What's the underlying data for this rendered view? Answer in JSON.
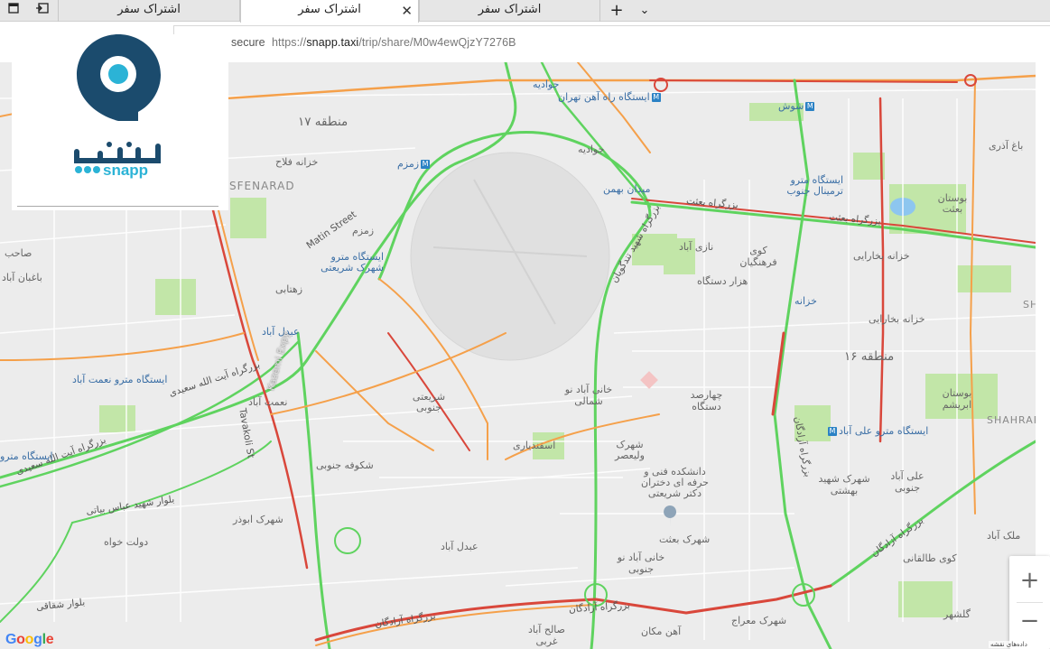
{
  "browser": {
    "tabs": [
      {
        "label": "اشتراک سفر",
        "active": false
      },
      {
        "label": "اشتراک سفر",
        "active": true
      },
      {
        "label": "اشتراک سفر",
        "active": false
      }
    ],
    "new_tab_symbol": "+",
    "tab_list_symbol": "⌄",
    "close_symbol": "✕",
    "icons": {
      "tab_actions": "tab-actions-icon",
      "set_aside": "set-aside-tabs-icon"
    },
    "address": {
      "secure_label": "secure",
      "url_scheme": "https://",
      "url_domain": "snapp.taxi",
      "url_path": "/trip/share/M0w4ewQjzY7276B"
    }
  },
  "logo": {
    "text_fa": "اسنپ",
    "text_en": "snapp",
    "brand_color": "#1b4b6d",
    "accent_color": "#2bb3d6"
  },
  "map": {
    "provider": "Google",
    "attribution": "داده‌های نقشه",
    "zoom_in_label": "+",
    "zoom_out_label": "−",
    "colors": {
      "traffic_green": "#5fd35f",
      "traffic_orange": "#f5a04a",
      "traffic_red": "#d9473b",
      "park": "#c2e6a8",
      "water": "#8dc6ef",
      "metro": "#2b82c5"
    },
    "labels": {
      "region17": "منطقه ۱۷",
      "region16": "منطقه ۱۶",
      "javadieh1": "جوادیه",
      "javadieh2": "جوادیه",
      "rah_ahan": "ایستگاه راه آهن تهران",
      "shoush": "شوش",
      "bagh_azari": "باغ آذری",
      "khazaneh_falah": "خزانه فلاح",
      "zamzam": "زمزم",
      "zamzam2": "زمزم",
      "sfenarad": "SFENARAD",
      "meydan_bahman": "میدان بهمن",
      "terminal_jonoub": "ایستگاه مترو ترمینال جنوب",
      "bustan_besat": "بوستان بعثت",
      "bozorgrah_besat": "بزرگراه بعثت",
      "azadegan_saeed": "بزرگراه شهید تندگویان",
      "shahrak_shariati_station": "ایستگاه مترو شهرک شریعتی",
      "matin_street": "Matin Street",
      "zahtabi": "زهتابی",
      "bazi_abad": "نازی آباد",
      "kooy_farhangian": "کوی فرهنگیان",
      "hezar_dastgah": "هزار دستگاه",
      "khazaneh": "خزانه",
      "khazaneh_bokharaei": "خزانه بخارایی",
      "khazaneh_bokharaei2": "خزانه بخارایی",
      "sh_right": "SH",
      "abdol_abad_station": "عبدل آباد",
      "kazemi_expy": "Kazemi Expy",
      "nemat_abad_station": "ایستگاه مترو نعمت آباد",
      "nemat_abad": "نعمت آباد",
      "shariati_jonoubi": "شریعتی جنوبی",
      "khani_abad_shomali": "خانی آباد نو شمالی",
      "chaharsad_dastgah": "چهارصد دستگاه",
      "esfandiari": "اسفندیاری",
      "valiasr_town": "شهرک ولیعصر",
      "daneshkadeh": "دانشکده فنی و حرفه ای دختران دکتر شریعتی",
      "bustan_abrisham": "بوستان ابریشم",
      "shahrar": "SHAHRAR",
      "ali_abad_station": "ایستگاه مترو علی آباد",
      "shahrak_shahid_behshti": "شهرک شهید بهشتی",
      "ali_abad_jonoubi": "علی آباد جنوبی",
      "ayatollah_saeedi": "بزرگراه آیت الله سعیدی",
      "station_left": "ایستگاه مترو",
      "shokufeh_jonoubi": "شکوفه جنوبی",
      "abouzar_town": "شهرک ابوذر",
      "dolat_khah": "دولت خواه",
      "abdol_abad": "عبدل آباد",
      "shahrak_besat": "شهرک بعثت",
      "khani_abad_jonoubi": "خانی آباد نو جنوبی",
      "bozorgrah_azadegan": "بزرگراه آزادگان",
      "azadegan_right": "بزرگراه آزادگان",
      "mellak_abad": "ملک آباد",
      "kooy_taleghani": "کوی طالقانی",
      "golshahr": "گلشهر",
      "shahrak_meraj": "شهرک معراج",
      "ahan_makan": "آهن مکان",
      "saleh_abad": "صالح آباد غربی",
      "tavakoli": "Tavakoli St",
      "sahebkaran": "صاحب",
      "baghban": "باغبان آباد",
      "bolvar_mokhaberat": "بلوار شهید عباس بیاتی",
      "bolvar_shaghaghi": "بلوار شقاقی"
    }
  }
}
